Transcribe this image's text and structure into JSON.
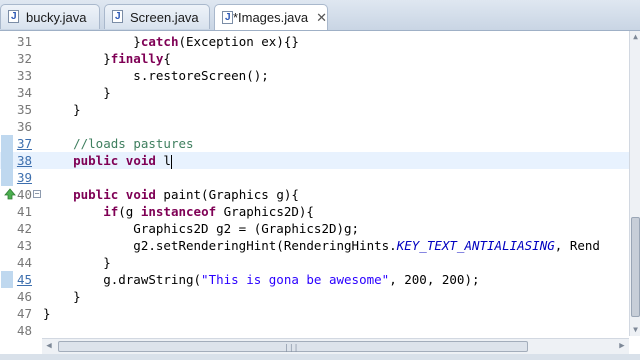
{
  "tabs": [
    {
      "label": "bucky.java",
      "active": false,
      "closable": false
    },
    {
      "label": "Screen.java",
      "active": false,
      "closable": false
    },
    {
      "label": "*Images.java",
      "active": true,
      "closable": true
    }
  ],
  "tab_close_glyph": "✕",
  "editor": {
    "current_line": 38,
    "lines": [
      {
        "num": "31",
        "segs": [
          {
            "t": "            }",
            "c": ""
          },
          {
            "t": "catch",
            "c": "kw"
          },
          {
            "t": "(Exception ex){}",
            "c": ""
          }
        ]
      },
      {
        "num": "32",
        "segs": [
          {
            "t": "        }",
            "c": ""
          },
          {
            "t": "finally",
            "c": "kw"
          },
          {
            "t": "{",
            "c": ""
          }
        ]
      },
      {
        "num": "33",
        "segs": [
          {
            "t": "            s.restoreScreen();",
            "c": ""
          }
        ]
      },
      {
        "num": "34",
        "segs": [
          {
            "t": "        }",
            "c": ""
          }
        ]
      },
      {
        "num": "35",
        "segs": [
          {
            "t": "    }",
            "c": ""
          }
        ]
      },
      {
        "num": "36",
        "segs": [
          {
            "t": "",
            "c": ""
          }
        ]
      },
      {
        "num": "37",
        "changed": true,
        "segs": [
          {
            "t": "    ",
            "c": ""
          },
          {
            "t": "//loads pastures",
            "c": "cm"
          }
        ]
      },
      {
        "num": "38",
        "changed": true,
        "segs": [
          {
            "t": "    ",
            "c": ""
          },
          {
            "t": "public",
            "c": "kw"
          },
          {
            "t": " ",
            "c": ""
          },
          {
            "t": "void",
            "c": "kw"
          },
          {
            "t": " l",
            "c": ""
          }
        ]
      },
      {
        "num": "39",
        "changed": true,
        "segs": [
          {
            "t": "",
            "c": ""
          }
        ]
      },
      {
        "num": "40",
        "fold": "⊖",
        "override": true,
        "segs": [
          {
            "t": "    ",
            "c": ""
          },
          {
            "t": "public",
            "c": "kw"
          },
          {
            "t": " ",
            "c": ""
          },
          {
            "t": "void",
            "c": "kw"
          },
          {
            "t": " paint(Graphics g){",
            "c": ""
          }
        ]
      },
      {
        "num": "41",
        "segs": [
          {
            "t": "        ",
            "c": ""
          },
          {
            "t": "if",
            "c": "kw"
          },
          {
            "t": "(g ",
            "c": ""
          },
          {
            "t": "instanceof",
            "c": "kw"
          },
          {
            "t": " Graphics2D){",
            "c": ""
          }
        ]
      },
      {
        "num": "42",
        "segs": [
          {
            "t": "            Graphics2D g2 = (Graphics2D)g;",
            "c": ""
          }
        ]
      },
      {
        "num": "43",
        "segs": [
          {
            "t": "            g2.setRenderingHint(RenderingHints.",
            "c": ""
          },
          {
            "t": "KEY_TEXT_ANTIALIASING",
            "c": "fi"
          },
          {
            "t": ", Rend",
            "c": ""
          }
        ]
      },
      {
        "num": "44",
        "segs": [
          {
            "t": "        }",
            "c": ""
          }
        ]
      },
      {
        "num": "45",
        "changed": true,
        "segs": [
          {
            "t": "        g.drawString(",
            "c": ""
          },
          {
            "t": "\"This is gona be awesome\"",
            "c": "st"
          },
          {
            "t": ", 200, 200);",
            "c": ""
          }
        ]
      },
      {
        "num": "46",
        "segs": [
          {
            "t": "    }",
            "c": ""
          }
        ]
      },
      {
        "num": "47",
        "segs": [
          {
            "t": "}",
            "c": ""
          }
        ]
      },
      {
        "num": "48",
        "segs": [
          {
            "t": "",
            "c": ""
          }
        ]
      }
    ]
  },
  "colors": {
    "keyword": "#7f0055",
    "comment": "#3f7f5f",
    "string": "#2a00ff",
    "static_field": "#0000c0",
    "current_line": "#e8f2fe",
    "change_marker": "#bfd8ef"
  },
  "icons": {
    "file_icon": "java-file-icon",
    "fold": "collapse-icon",
    "override": "override-arrow-icon"
  }
}
